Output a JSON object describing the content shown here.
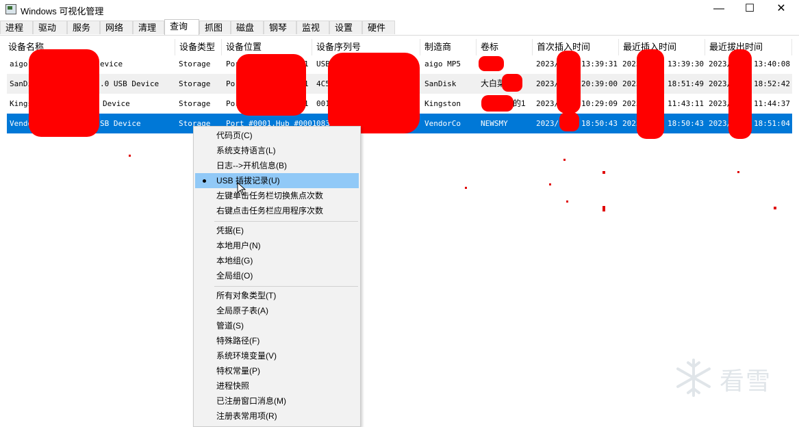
{
  "window": {
    "title": "Windows 可视化管理",
    "controls": {
      "minimize": "—",
      "maximize": "☐",
      "close": "✕"
    }
  },
  "tabs": [
    "进程",
    "驱动",
    "服务",
    "网络",
    "清理",
    "查询",
    "抓图",
    "磁盘",
    "钢琴",
    "监视",
    "设置",
    "硬件"
  ],
  "active_tab": "查询",
  "table": {
    "headers": [
      "设备名称",
      "设备类型",
      "设备位置",
      "设备序列号",
      "制造商",
      "卷标",
      "首次插入时间",
      "最近插入时间",
      "最近拔出时间"
    ],
    "rows": [
      [
        "aigo",
        "evice",
        "Storage",
        "Por",
        "1",
        "USB",
        "aigo MP5",
        "",
        "2023/",
        "13:39:31",
        "2023/",
        "13:39:30",
        "2023/",
        "13:40:08"
      ],
      [
        "SanDi",
        ".0 USB Device",
        "Storage",
        "Por",
        "1",
        "4C5",
        "SanDisk",
        "大白菜",
        "2023/",
        "20:39:00",
        "2023/",
        "18:51:49",
        "2023/",
        "18:52:42"
      ],
      [
        "Kings",
        "Device",
        "Storage",
        "Por",
        "1",
        "001",
        "Kingston",
        "的1",
        "2023/",
        "10:29:09",
        "2023/",
        "11:43:11",
        "2023/",
        "11:44:37"
      ],
      [
        "Vendo",
        "SB Device",
        "Storage",
        "Port_#0001.Hub_#0001",
        "",
        "083",
        "VendorCo",
        "NEWSMY",
        "2023/",
        "18:50:43",
        "2023/",
        "18:50:43",
        "2023/",
        "18:51:04"
      ]
    ]
  },
  "context_menu": {
    "items": [
      "代码页(C)",
      "系统支持语言(L)",
      "日志-->开机信息(B)",
      "USB 插拔记录(U)",
      "左键单击任务栏切换焦点次数",
      "右键点击任务栏应用程序次数",
      "凭据(E)",
      "本地用户(N)",
      "本地组(G)",
      "全局组(O)",
      "所有对象类型(T)",
      "全局原子表(A)",
      "管道(S)",
      "特殊路径(F)",
      "系统环境变量(V)",
      "特权常量(P)",
      "进程快照",
      "已注册窗口消息(M)",
      "注册表常用项(R)"
    ],
    "checked_item": "USB 插拔记录(U)"
  },
  "watermark": {
    "text": "看雪",
    "icon": "snowflake-icon"
  },
  "colors": {
    "selection": "#0078d7",
    "menu_highlight": "#91c9f7",
    "redaction": "#ff0000"
  }
}
